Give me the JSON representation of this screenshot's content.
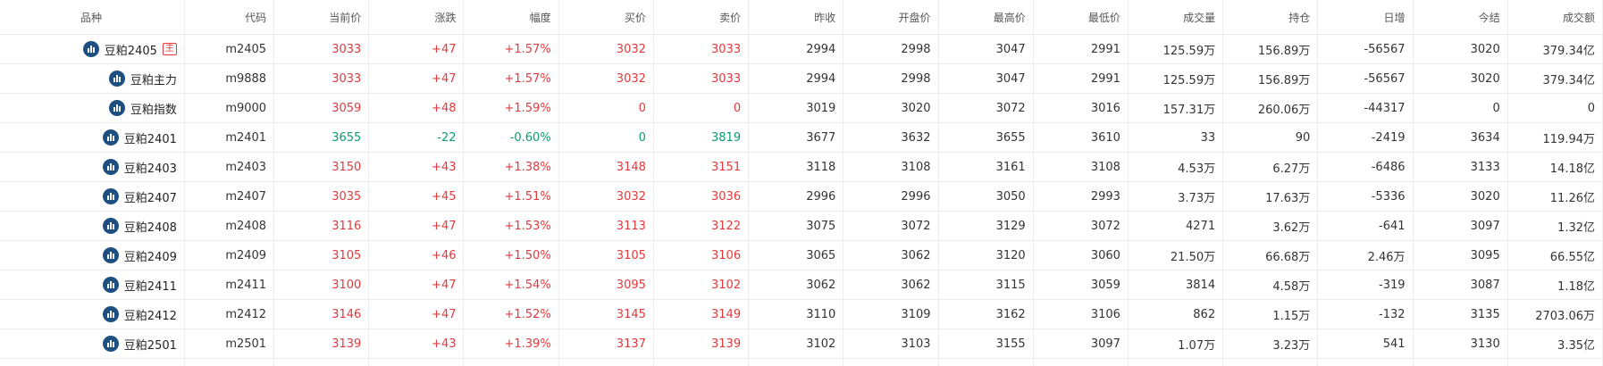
{
  "colors": {
    "up": "#e3393c",
    "down": "#0c9c71",
    "icon": "#1d4f82"
  },
  "columns": [
    "品种",
    "代码",
    "当前价",
    "涨跌",
    "幅度",
    "买价",
    "卖价",
    "昨收",
    "开盘价",
    "最高价",
    "最低价",
    "成交量",
    "持仓",
    "日增",
    "今结",
    "成交额"
  ],
  "rows": [
    {
      "name": "豆粕2405",
      "tag": "主",
      "code": "m2405",
      "price": "3033",
      "change": "+47",
      "pct": "+1.57%",
      "bid": "3032",
      "ask": "3033",
      "prev_close": "2994",
      "open": "2998",
      "high": "3047",
      "low": "2991",
      "volume": "125.59万",
      "open_interest": "156.89万",
      "daily_change": "-56567",
      "settle": "3020",
      "turnover": "379.34亿",
      "trend": "up",
      "bid_trend": "up",
      "ask_trend": "up"
    },
    {
      "name": "豆粕主力",
      "tag": "",
      "code": "m9888",
      "price": "3033",
      "change": "+47",
      "pct": "+1.57%",
      "bid": "3032",
      "ask": "3033",
      "prev_close": "2994",
      "open": "2998",
      "high": "3047",
      "low": "2991",
      "volume": "125.59万",
      "open_interest": "156.89万",
      "daily_change": "-56567",
      "settle": "3020",
      "turnover": "379.34亿",
      "trend": "up",
      "bid_trend": "up",
      "ask_trend": "up"
    },
    {
      "name": "豆粕指数",
      "tag": "",
      "code": "m9000",
      "price": "3059",
      "change": "+48",
      "pct": "+1.59%",
      "bid": "0",
      "ask": "0",
      "prev_close": "3019",
      "open": "3020",
      "high": "3072",
      "low": "3016",
      "volume": "157.31万",
      "open_interest": "260.06万",
      "daily_change": "-44317",
      "settle": "0",
      "turnover": "0",
      "trend": "up",
      "bid_trend": "up",
      "ask_trend": "up"
    },
    {
      "name": "豆粕2401",
      "tag": "",
      "code": "m2401",
      "price": "3655",
      "change": "-22",
      "pct": "-0.60%",
      "bid": "0",
      "ask": "3819",
      "prev_close": "3677",
      "open": "3632",
      "high": "3655",
      "low": "3610",
      "volume": "33",
      "open_interest": "90",
      "daily_change": "-2419",
      "settle": "3634",
      "turnover": "119.94万",
      "trend": "down",
      "bid_trend": "down",
      "ask_trend": "down"
    },
    {
      "name": "豆粕2403",
      "tag": "",
      "code": "m2403",
      "price": "3150",
      "change": "+43",
      "pct": "+1.38%",
      "bid": "3148",
      "ask": "3151",
      "prev_close": "3118",
      "open": "3108",
      "high": "3161",
      "low": "3108",
      "volume": "4.53万",
      "open_interest": "6.27万",
      "daily_change": "-6486",
      "settle": "3133",
      "turnover": "14.18亿",
      "trend": "up",
      "bid_trend": "up",
      "ask_trend": "up"
    },
    {
      "name": "豆粕2407",
      "tag": "",
      "code": "m2407",
      "price": "3035",
      "change": "+45",
      "pct": "+1.51%",
      "bid": "3032",
      "ask": "3036",
      "prev_close": "2996",
      "open": "2996",
      "high": "3050",
      "low": "2993",
      "volume": "3.73万",
      "open_interest": "17.63万",
      "daily_change": "-5336",
      "settle": "3020",
      "turnover": "11.26亿",
      "trend": "up",
      "bid_trend": "up",
      "ask_trend": "up"
    },
    {
      "name": "豆粕2408",
      "tag": "",
      "code": "m2408",
      "price": "3116",
      "change": "+47",
      "pct": "+1.53%",
      "bid": "3113",
      "ask": "3122",
      "prev_close": "3075",
      "open": "3072",
      "high": "3129",
      "low": "3072",
      "volume": "4271",
      "open_interest": "3.62万",
      "daily_change": "-641",
      "settle": "3097",
      "turnover": "1.32亿",
      "trend": "up",
      "bid_trend": "up",
      "ask_trend": "up"
    },
    {
      "name": "豆粕2409",
      "tag": "",
      "code": "m2409",
      "price": "3105",
      "change": "+46",
      "pct": "+1.50%",
      "bid": "3105",
      "ask": "3106",
      "prev_close": "3065",
      "open": "3062",
      "high": "3120",
      "low": "3060",
      "volume": "21.50万",
      "open_interest": "66.68万",
      "daily_change": "2.46万",
      "settle": "3095",
      "turnover": "66.55亿",
      "trend": "up",
      "bid_trend": "up",
      "ask_trend": "up"
    },
    {
      "name": "豆粕2411",
      "tag": "",
      "code": "m2411",
      "price": "3100",
      "change": "+47",
      "pct": "+1.54%",
      "bid": "3095",
      "ask": "3102",
      "prev_close": "3062",
      "open": "3062",
      "high": "3115",
      "low": "3059",
      "volume": "3814",
      "open_interest": "4.58万",
      "daily_change": "-319",
      "settle": "3087",
      "turnover": "1.18亿",
      "trend": "up",
      "bid_trend": "up",
      "ask_trend": "up"
    },
    {
      "name": "豆粕2412",
      "tag": "",
      "code": "m2412",
      "price": "3146",
      "change": "+47",
      "pct": "+1.52%",
      "bid": "3145",
      "ask": "3149",
      "prev_close": "3110",
      "open": "3109",
      "high": "3162",
      "low": "3106",
      "volume": "862",
      "open_interest": "1.15万",
      "daily_change": "-132",
      "settle": "3135",
      "turnover": "2703.06万",
      "trend": "up",
      "bid_trend": "up",
      "ask_trend": "up"
    },
    {
      "name": "豆粕2501",
      "tag": "",
      "code": "m2501",
      "price": "3139",
      "change": "+43",
      "pct": "+1.39%",
      "bid": "3137",
      "ask": "3139",
      "prev_close": "3102",
      "open": "3103",
      "high": "3155",
      "low": "3097",
      "volume": "1.07万",
      "open_interest": "3.23万",
      "daily_change": "541",
      "settle": "3130",
      "turnover": "3.35亿",
      "trend": "up",
      "bid_trend": "up",
      "ask_trend": "up"
    }
  ]
}
